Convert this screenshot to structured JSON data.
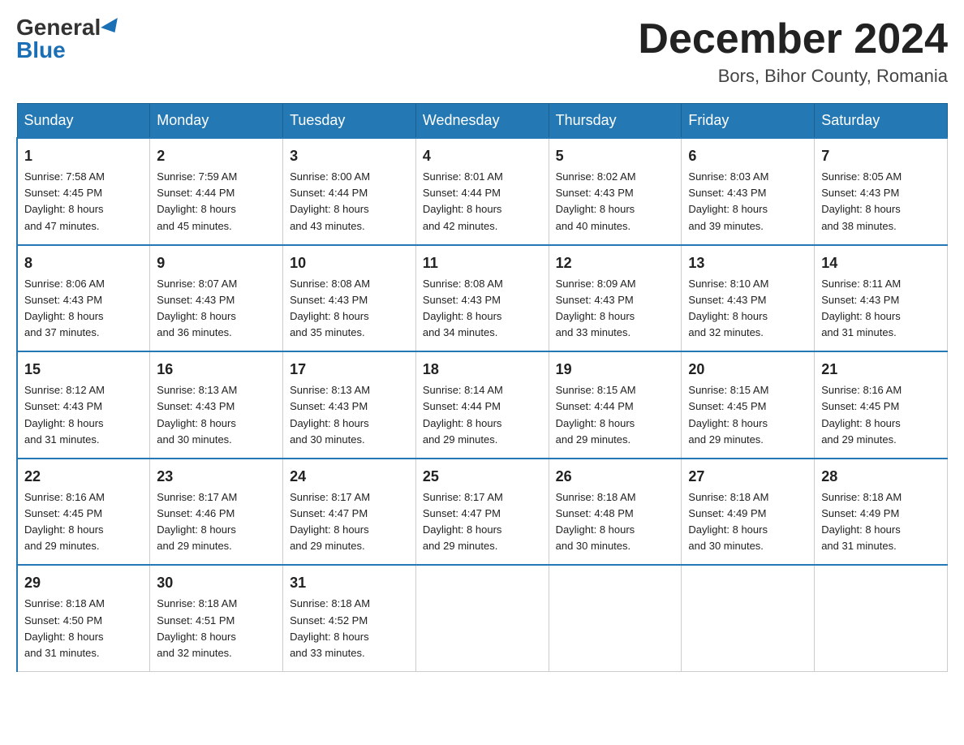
{
  "header": {
    "logo_general": "General",
    "logo_blue": "Blue",
    "month_title": "December 2024",
    "location": "Bors, Bihor County, Romania"
  },
  "calendar": {
    "days_of_week": [
      "Sunday",
      "Monday",
      "Tuesday",
      "Wednesday",
      "Thursday",
      "Friday",
      "Saturday"
    ],
    "weeks": [
      [
        {
          "day": "1",
          "sunrise": "7:58 AM",
          "sunset": "4:45 PM",
          "daylight": "8 hours and 47 minutes."
        },
        {
          "day": "2",
          "sunrise": "7:59 AM",
          "sunset": "4:44 PM",
          "daylight": "8 hours and 45 minutes."
        },
        {
          "day": "3",
          "sunrise": "8:00 AM",
          "sunset": "4:44 PM",
          "daylight": "8 hours and 43 minutes."
        },
        {
          "day": "4",
          "sunrise": "8:01 AM",
          "sunset": "4:44 PM",
          "daylight": "8 hours and 42 minutes."
        },
        {
          "day": "5",
          "sunrise": "8:02 AM",
          "sunset": "4:43 PM",
          "daylight": "8 hours and 40 minutes."
        },
        {
          "day": "6",
          "sunrise": "8:03 AM",
          "sunset": "4:43 PM",
          "daylight": "8 hours and 39 minutes."
        },
        {
          "day": "7",
          "sunrise": "8:05 AM",
          "sunset": "4:43 PM",
          "daylight": "8 hours and 38 minutes."
        }
      ],
      [
        {
          "day": "8",
          "sunrise": "8:06 AM",
          "sunset": "4:43 PM",
          "daylight": "8 hours and 37 minutes."
        },
        {
          "day": "9",
          "sunrise": "8:07 AM",
          "sunset": "4:43 PM",
          "daylight": "8 hours and 36 minutes."
        },
        {
          "day": "10",
          "sunrise": "8:08 AM",
          "sunset": "4:43 PM",
          "daylight": "8 hours and 35 minutes."
        },
        {
          "day": "11",
          "sunrise": "8:08 AM",
          "sunset": "4:43 PM",
          "daylight": "8 hours and 34 minutes."
        },
        {
          "day": "12",
          "sunrise": "8:09 AM",
          "sunset": "4:43 PM",
          "daylight": "8 hours and 33 minutes."
        },
        {
          "day": "13",
          "sunrise": "8:10 AM",
          "sunset": "4:43 PM",
          "daylight": "8 hours and 32 minutes."
        },
        {
          "day": "14",
          "sunrise": "8:11 AM",
          "sunset": "4:43 PM",
          "daylight": "8 hours and 31 minutes."
        }
      ],
      [
        {
          "day": "15",
          "sunrise": "8:12 AM",
          "sunset": "4:43 PM",
          "daylight": "8 hours and 31 minutes."
        },
        {
          "day": "16",
          "sunrise": "8:13 AM",
          "sunset": "4:43 PM",
          "daylight": "8 hours and 30 minutes."
        },
        {
          "day": "17",
          "sunrise": "8:13 AM",
          "sunset": "4:43 PM",
          "daylight": "8 hours and 30 minutes."
        },
        {
          "day": "18",
          "sunrise": "8:14 AM",
          "sunset": "4:44 PM",
          "daylight": "8 hours and 29 minutes."
        },
        {
          "day": "19",
          "sunrise": "8:15 AM",
          "sunset": "4:44 PM",
          "daylight": "8 hours and 29 minutes."
        },
        {
          "day": "20",
          "sunrise": "8:15 AM",
          "sunset": "4:45 PM",
          "daylight": "8 hours and 29 minutes."
        },
        {
          "day": "21",
          "sunrise": "8:16 AM",
          "sunset": "4:45 PM",
          "daylight": "8 hours and 29 minutes."
        }
      ],
      [
        {
          "day": "22",
          "sunrise": "8:16 AM",
          "sunset": "4:45 PM",
          "daylight": "8 hours and 29 minutes."
        },
        {
          "day": "23",
          "sunrise": "8:17 AM",
          "sunset": "4:46 PM",
          "daylight": "8 hours and 29 minutes."
        },
        {
          "day": "24",
          "sunrise": "8:17 AM",
          "sunset": "4:47 PM",
          "daylight": "8 hours and 29 minutes."
        },
        {
          "day": "25",
          "sunrise": "8:17 AM",
          "sunset": "4:47 PM",
          "daylight": "8 hours and 29 minutes."
        },
        {
          "day": "26",
          "sunrise": "8:18 AM",
          "sunset": "4:48 PM",
          "daylight": "8 hours and 30 minutes."
        },
        {
          "day": "27",
          "sunrise": "8:18 AM",
          "sunset": "4:49 PM",
          "daylight": "8 hours and 30 minutes."
        },
        {
          "day": "28",
          "sunrise": "8:18 AM",
          "sunset": "4:49 PM",
          "daylight": "8 hours and 31 minutes."
        }
      ],
      [
        {
          "day": "29",
          "sunrise": "8:18 AM",
          "sunset": "4:50 PM",
          "daylight": "8 hours and 31 minutes."
        },
        {
          "day": "30",
          "sunrise": "8:18 AM",
          "sunset": "4:51 PM",
          "daylight": "8 hours and 32 minutes."
        },
        {
          "day": "31",
          "sunrise": "8:18 AM",
          "sunset": "4:52 PM",
          "daylight": "8 hours and 33 minutes."
        },
        null,
        null,
        null,
        null
      ]
    ],
    "labels": {
      "sunrise": "Sunrise: ",
      "sunset": "Sunset: ",
      "daylight": "Daylight: "
    }
  }
}
